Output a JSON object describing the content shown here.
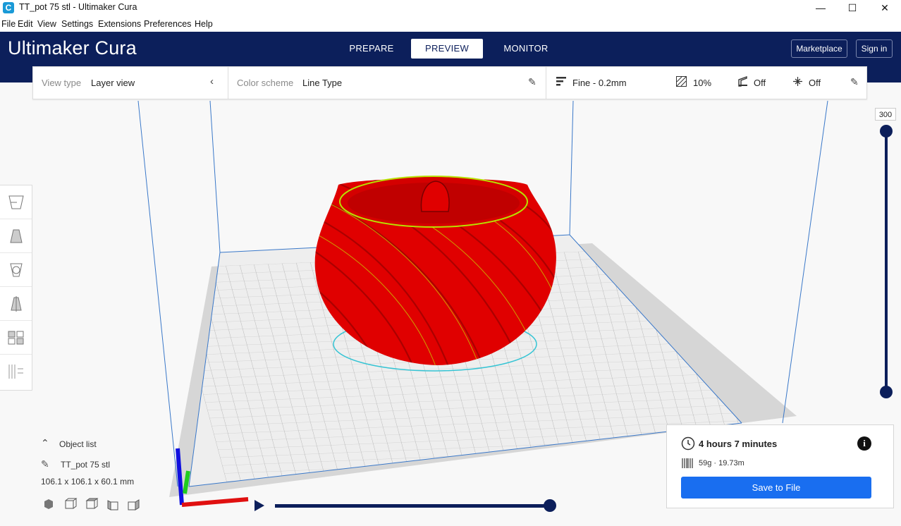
{
  "window": {
    "title": "TT_pot 75 stl - Ultimaker Cura",
    "app_icon": "C",
    "controls": {
      "minimize": "—",
      "maximize": "☐",
      "close": "✕"
    }
  },
  "menu": [
    "File",
    "Edit",
    "View",
    "Settings",
    "Extensions",
    "Preferences",
    "Help"
  ],
  "header": {
    "logo_brand": "Ultimaker",
    "logo_product": "Cura",
    "tabs": {
      "prepare": "PREPARE",
      "preview": "PREVIEW",
      "monitor": "MONITOR"
    },
    "active_tab": "PREVIEW",
    "marketplace": "Marketplace",
    "signin": "Sign in"
  },
  "toolbar": {
    "view_type_label": "View type",
    "view_type_value": "Layer view",
    "color_scheme_label": "Color scheme",
    "color_scheme_value": "Line Type",
    "profile": "Fine - 0.2mm",
    "infill": "10%",
    "support": "Off",
    "adhesion": "Off"
  },
  "layer_slider": {
    "max_label": "300"
  },
  "object_list": {
    "header": "Object list",
    "object_name": "TT_pot 75 stl",
    "dimensions": "106.1 x 106.1 x 60.1 mm"
  },
  "print_info": {
    "time": "4 hours 7 minutes",
    "material": "59g · 19.73m",
    "save_button": "Save to File"
  },
  "colors": {
    "header_bg": "#0c1f5b",
    "accent": "#196ef0",
    "model": "#e00000"
  }
}
